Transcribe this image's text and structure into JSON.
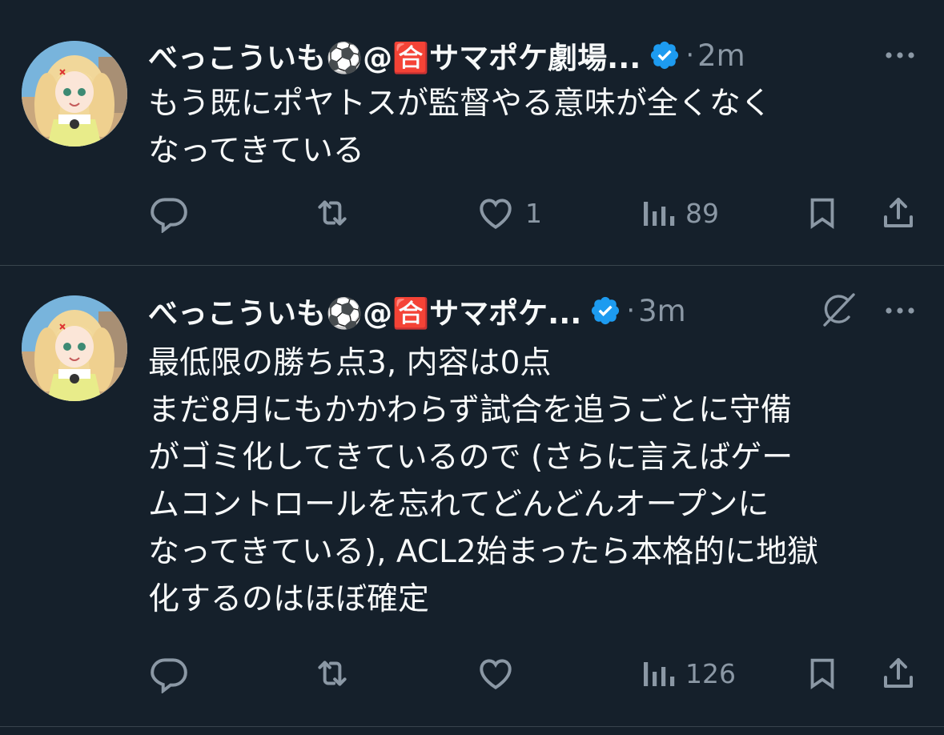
{
  "tweets": [
    {
      "display_name": "べっこういも⚽@🈴サマポケ劇場...",
      "verified": true,
      "time": "2m",
      "separator": "·",
      "text_lines": [
        "もう既にポヤトスが監督やる意味が全くなく",
        "なってきている"
      ],
      "actions": {
        "replies": "",
        "reposts": "",
        "likes": "1",
        "views": "89"
      }
    },
    {
      "display_name": "べっこういも⚽@🈴サマポケ...",
      "verified": true,
      "time": "3m",
      "separator": "·",
      "text_lines": [
        "最低限の勝ち点3, 内容は0点",
        "まだ8月にもかかわらず試合を追うごとに守備",
        "がゴミ化してきているので (さらに言えばゲー",
        "ムコントロールを忘れてどんどんオープンに",
        "なってきている), ACL2始まったら本格的に地獄",
        "化するのはほぼ確定"
      ],
      "actions": {
        "replies": "",
        "reposts": "",
        "likes": "",
        "views": "126"
      }
    }
  ],
  "icons": {
    "reply": "reply-icon",
    "repost": "repost-icon",
    "like": "heart-icon",
    "views": "views-chart-icon",
    "bookmark": "bookmark-icon",
    "share": "share-icon",
    "more": "more-dots-icon",
    "verified": "verified-badge-icon",
    "grok": "grok-icon"
  },
  "colors": {
    "background": "#15202b",
    "text": "#f7f9f9",
    "secondary": "#8b98a5",
    "verified": "#1d9bf0",
    "divider": "#38444d"
  }
}
